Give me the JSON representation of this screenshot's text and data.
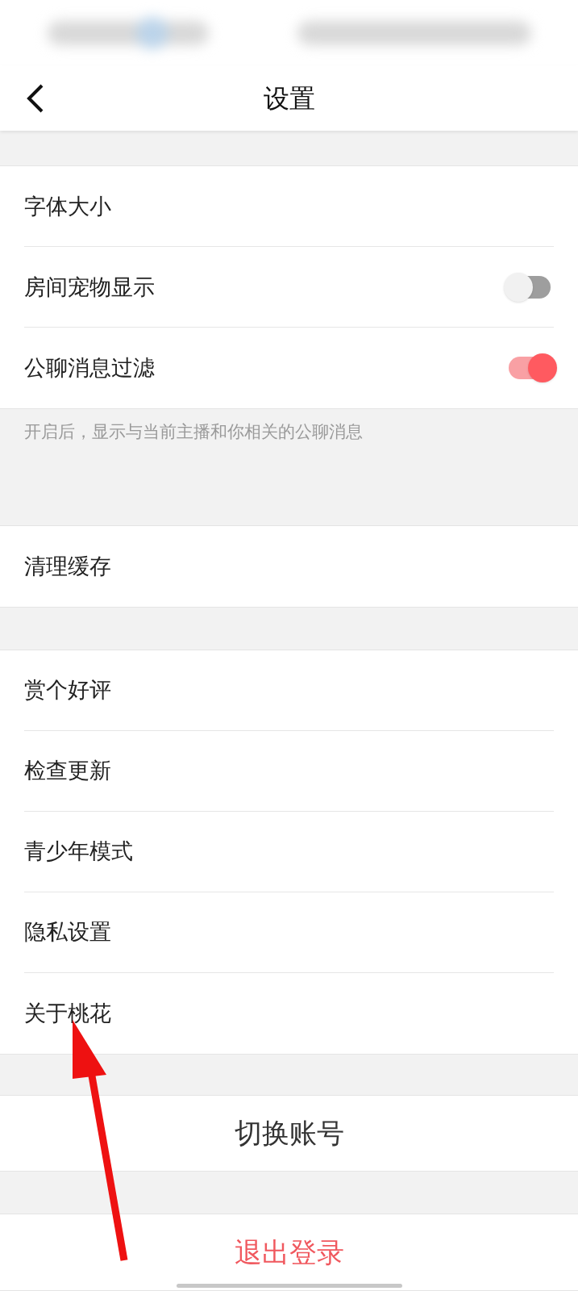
{
  "header": {
    "title": "设置"
  },
  "sections": [
    {
      "rows": [
        {
          "label": "字体大小",
          "kind": "plain"
        },
        {
          "label": "房间宠物显示",
          "kind": "toggle",
          "on": false
        },
        {
          "label": "公聊消息过滤",
          "kind": "toggle",
          "on": true
        }
      ],
      "hint": "开启后，显示与当前主播和你相关的公聊消息"
    },
    {
      "rows": [
        {
          "label": "清理缓存",
          "kind": "plain"
        }
      ]
    },
    {
      "rows": [
        {
          "label": "赏个好评",
          "kind": "plain"
        },
        {
          "label": "检查更新",
          "kind": "plain"
        },
        {
          "label": "青少年模式",
          "kind": "plain"
        },
        {
          "label": "隐私设置",
          "kind": "plain"
        },
        {
          "label": "关于桃花",
          "kind": "plain"
        }
      ]
    }
  ],
  "switch_account": "切换账号",
  "logout": "退出登录"
}
